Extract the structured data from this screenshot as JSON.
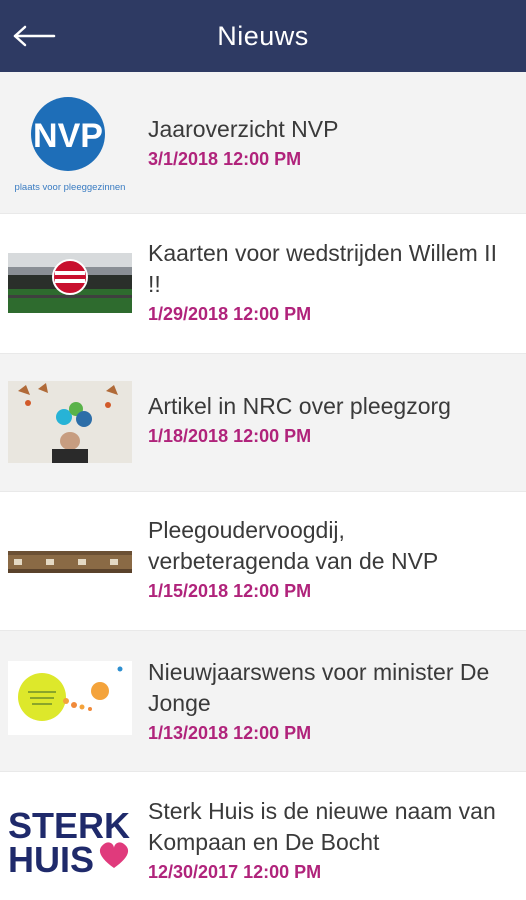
{
  "header": {
    "title": "Nieuws",
    "back_icon": "arrow-left-icon",
    "background": "#2e3a63"
  },
  "news": [
    {
      "title": "Jaaroverzicht NVP",
      "date": "3/1/2018 12:00 PM",
      "thumb_logo_text": "NVP",
      "thumb_caption": "plaats voor pleeggezinnen"
    },
    {
      "title": "Kaarten voor wedstrijden Willem II !!",
      "date": "1/29/2018 12:00 PM"
    },
    {
      "title": "Artikel in NRC over pleegzorg",
      "date": "1/18/2018 12:00 PM"
    },
    {
      "title": "Pleegoudervoogdij, verbeteragenda van de NVP",
      "date": "1/15/2018 12:00 PM"
    },
    {
      "title": "Nieuwjaarswens voor minister De Jonge",
      "date": "1/13/2018 12:00 PM"
    },
    {
      "title": "Sterk Huis is de nieuwe naam van Kompaan en De Bocht",
      "date": "12/30/2017 12:00 PM",
      "thumb_logo_line1": "STERK",
      "thumb_logo_line2": "HUIS"
    }
  ],
  "colors": {
    "date": "#b0237b",
    "title": "#3a3a3a",
    "row_grey": "#f3f3f3"
  }
}
